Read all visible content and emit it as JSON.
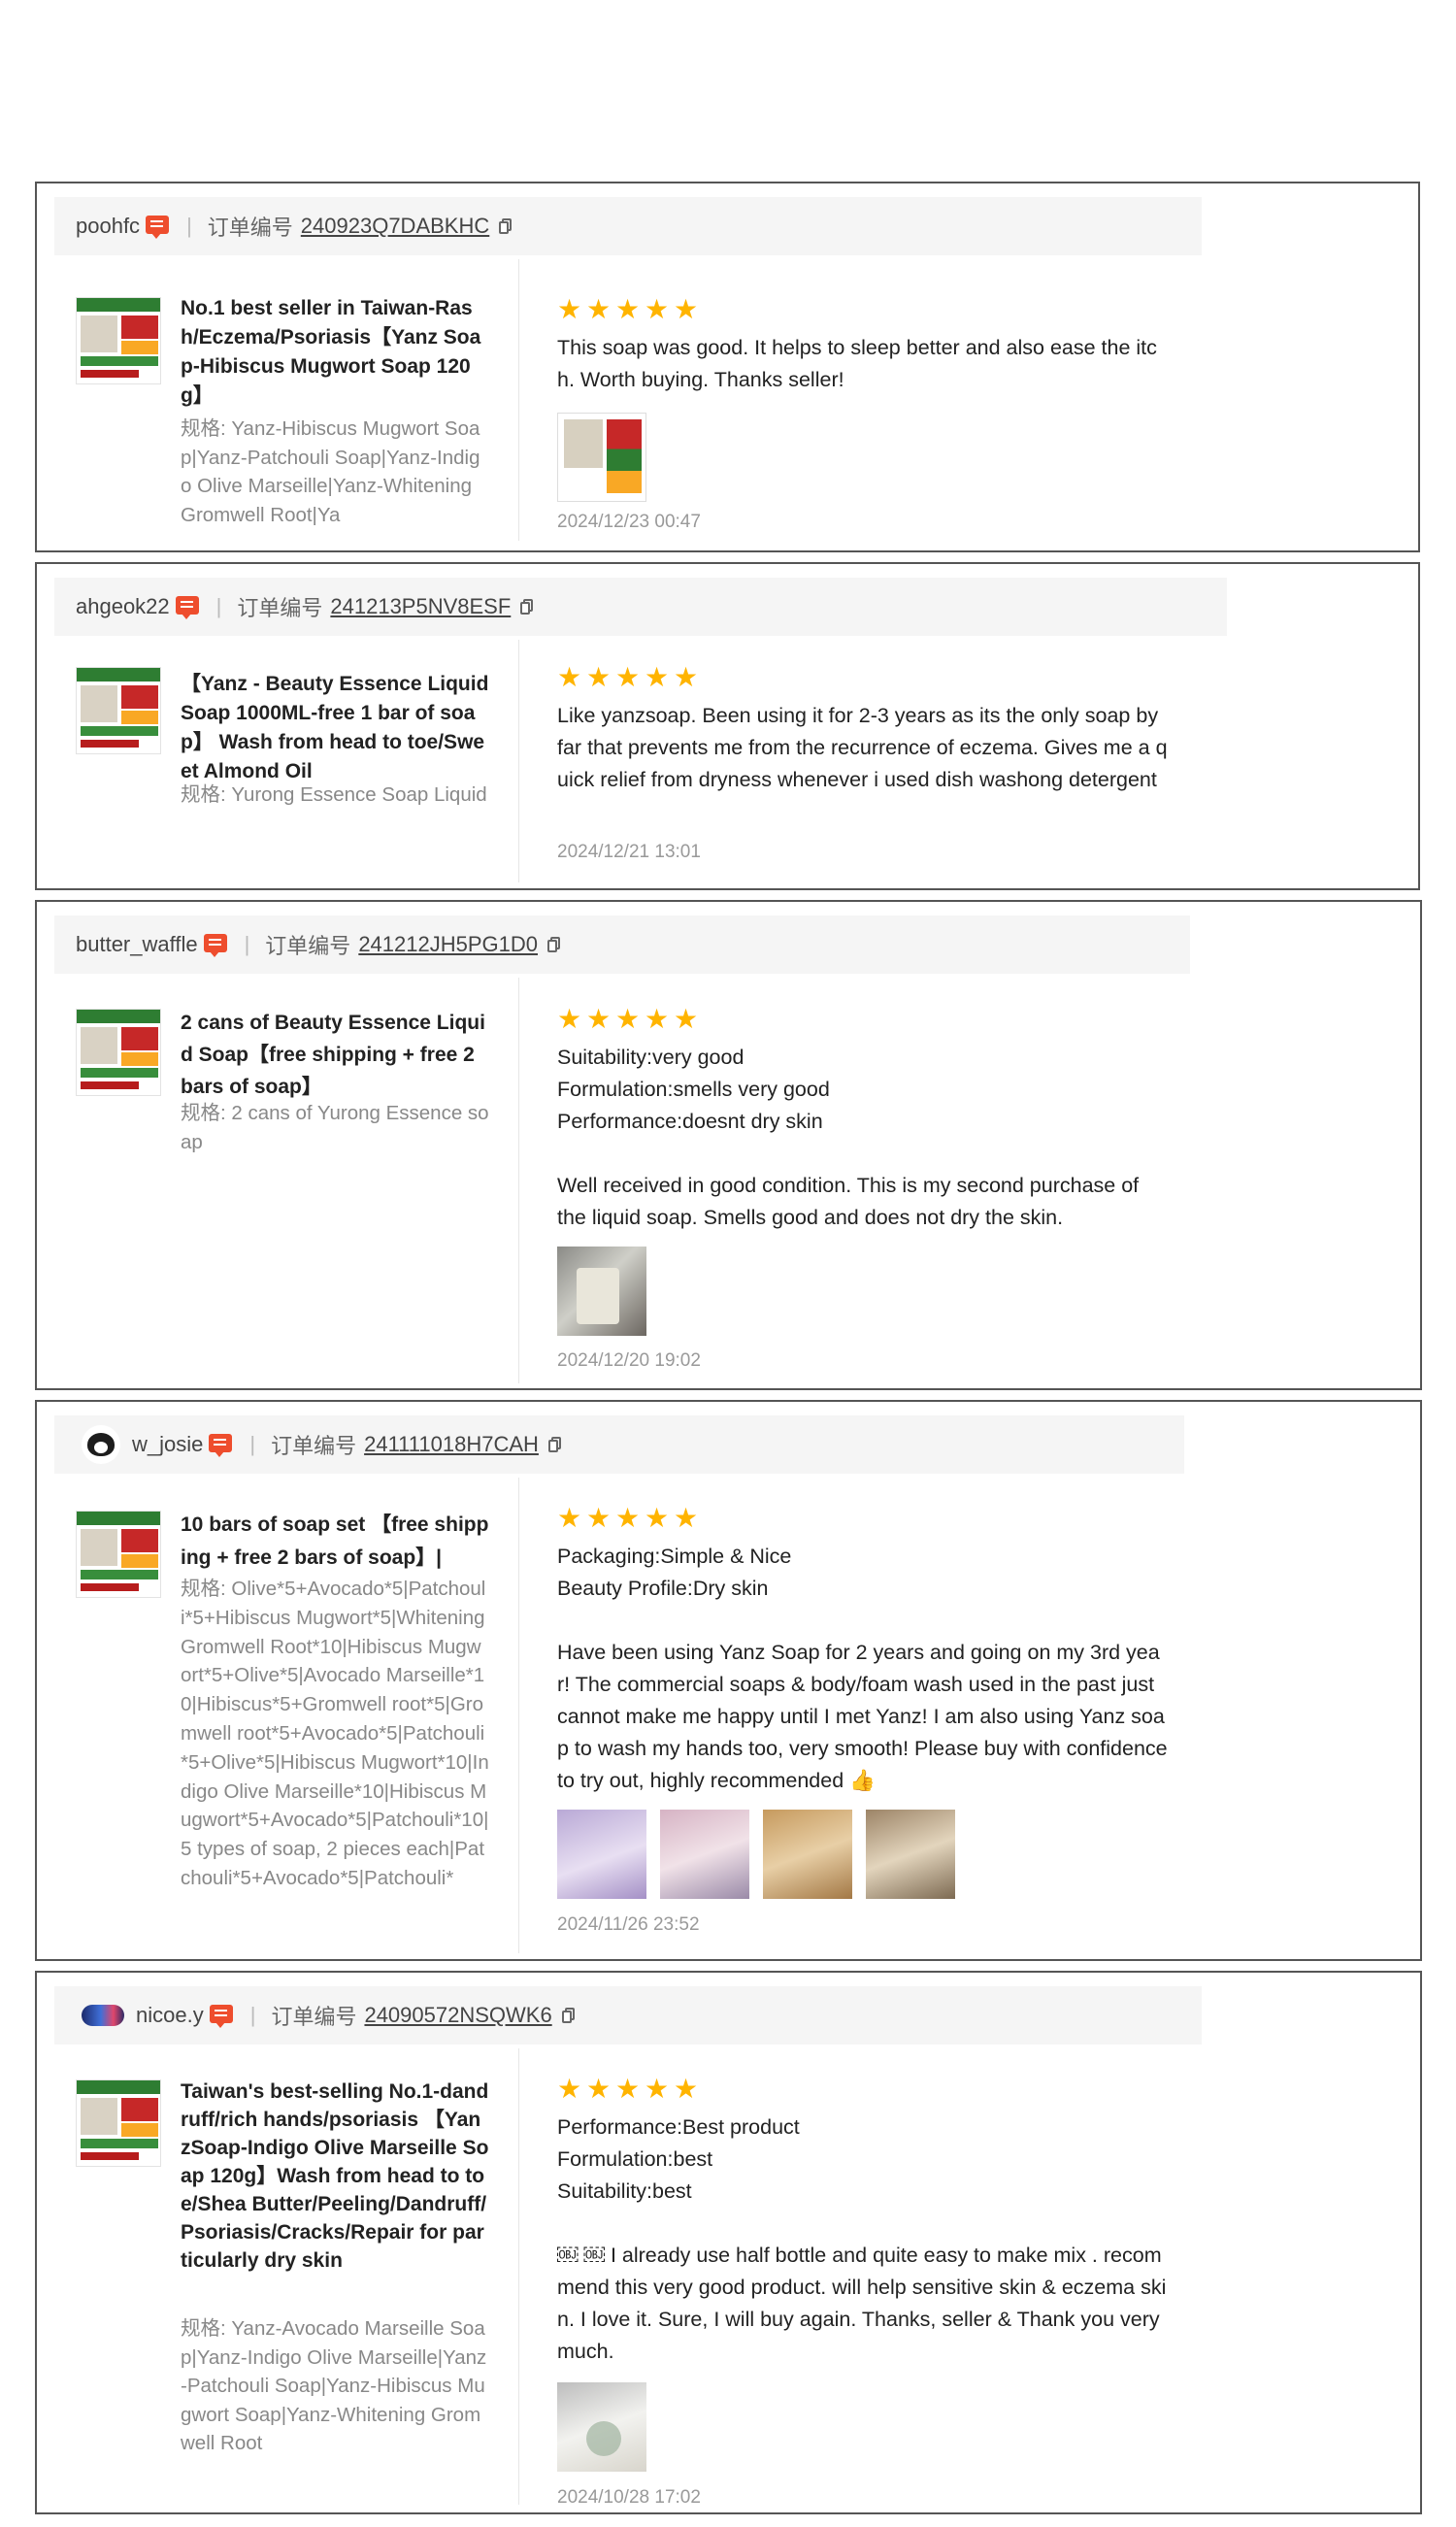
{
  "order_label": "订单编号",
  "spec_prefix": "规格: ",
  "reviews": [
    {
      "username": "poohfc",
      "order_no": "240923Q7DABKHC",
      "product_title": "No.1 best seller in Taiwan-Rash/Eczema/Psoriasis【Yanz Soap-Hibiscus Mugwort Soap 120g】",
      "spec": "Yanz-Hibiscus Mugwort Soap|Yanz-Patchouli Soap|Yanz-Indigo Olive Marseille|Yanz-Whitening Gromwell Root|Ya",
      "rating": 5,
      "text": [
        "This soap was good. It helps to sleep better and also ease the itch. Worth buying. Thanks seller!"
      ],
      "photos": [
        "product-photo"
      ],
      "date": "2024/12/23 00:47"
    },
    {
      "username": "ahgeok22",
      "order_no": "241213P5NV8ESF",
      "product_title": "【Yanz - Beauty Essence Liquid Soap 1000ML-free 1 bar of soap】 Wash from head to toe/Sweet Almond Oil",
      "spec": "Yurong Essence Soap Liquid",
      "rating": 5,
      "text": [
        "Like yanzsoap. Been using it for 2-3 years as its the only soap by far that prevents me from the recurrence of eczema. Gives me a quick relief from dryness whenever i used dish washong detergent"
      ],
      "photos": [],
      "date": "2024/12/21 13:01"
    },
    {
      "username": "butter_waffle",
      "order_no": "241212JH5PG1D0",
      "product_title": "2 cans of Beauty Essence Liquid Soap【free shipping + free 2 bars of soap】",
      "spec": "2 cans of Yurong Essence soap",
      "rating": 5,
      "text": [
        "Suitability:very good",
        "Formulation:smells very good",
        "Performance:doesnt dry skin",
        "",
        "Well received in good condition. This is my second purchase of the liquid soap. Smells good and does not dry the skin."
      ],
      "photos": [
        "package-photo"
      ],
      "date": "2024/12/20 19:02"
    },
    {
      "username": "w_josie",
      "order_no": "241111018H7CAH",
      "product_title": "10 bars of soap set 【free shipping + free 2 bars of soap】|",
      "spec": "Olive*5+Avocado*5|Patchouli*5+Hibiscus Mugwort*5|Whitening Gromwell Root*10|Hibiscus Mugwort*5+Olive*5|Avocado Marseille*10|Hibiscus*5+Gromwell root*5|Gromwell root*5+Avocado*5|Patchouli*5+Olive*5|Hibiscus Mugwort*10|Indigo Olive Marseille*10|Hibiscus Mugwort*5+Avocado*5|Patchouli*10|5 types of soap, 2 pieces each|Patchouli*5+Avocado*5|Patchouli*",
      "rating": 5,
      "text": [
        "Packaging:Simple & Nice",
        "Beauty Profile:Dry skin",
        "",
        "Have been using Yanz Soap for 2 years and going on my 3rd year! The commercial soaps & body/foam wash used in the past just cannot make me happy until I met Yanz! I am also using Yanz soap to wash my hands too, very smooth! Please buy with confidence to try out, highly recommended 👍"
      ],
      "photos": [
        "soap-photo-1",
        "soap-photo-2",
        "soap-photo-3",
        "soap-photo-4"
      ],
      "date": "2024/11/26 23:52"
    },
    {
      "username": "nicoe.y",
      "order_no": "24090572NSQWK6",
      "product_title": "Taiwan's best-selling No.1-dandruff/rich hands/psoriasis 【YanzSoap-Indigo Olive Marseille Soap 120g】Wash from head to toe/Shea Butter/Peeling/Dandruff/Psoriasis/Cracks/Repair for particularly dry skin",
      "spec": "Yanz-Avocado Marseille Soap|Yanz-Indigo Olive Marseille|Yanz-Patchouli Soap|Yanz-Hibiscus Mugwort Soap|Yanz-Whitening Gromwell Root",
      "rating": 5,
      "text": [
        "Performance:Best product",
        "Formulation:best",
        "Suitability:best",
        "",
        "￼ ￼ I already use half bottle and quite easy to make mix . recommend this very good product. will help sensitive skin & eczema skin. I love it. Sure, I will buy again. Thanks, seller  & Thank you very much."
      ],
      "photos": [
        "soap-in-hand-photo"
      ],
      "date": "2024/10/28 17:02"
    }
  ]
}
